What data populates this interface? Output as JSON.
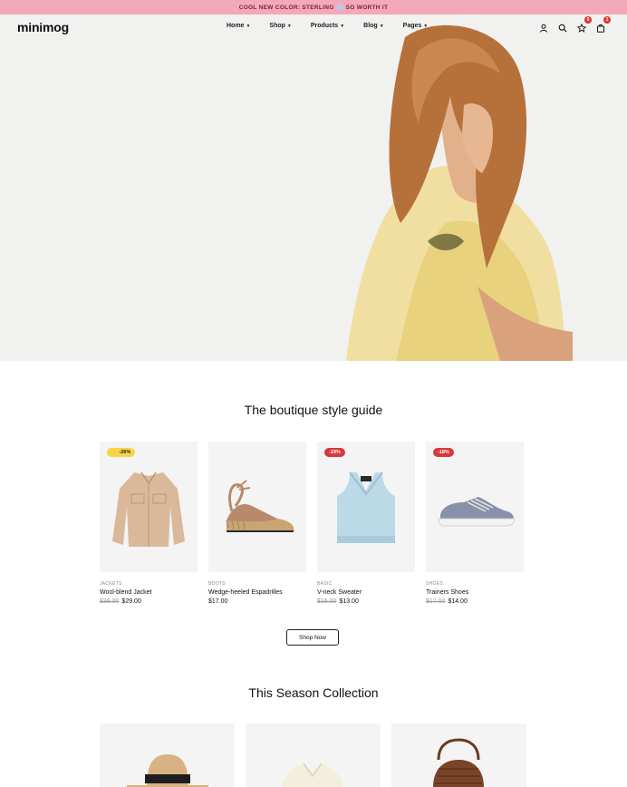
{
  "announcement": {
    "text_before": "COOL NEW COLOR: STERLING",
    "text_after": "SO WORTH IT"
  },
  "header": {
    "logo": "minimog",
    "nav": [
      {
        "label": "Home"
      },
      {
        "label": "Shop"
      },
      {
        "label": "Products"
      },
      {
        "label": "Blog"
      },
      {
        "label": "Pages"
      }
    ],
    "icons": [
      "user-icon",
      "search-icon",
      "star-icon",
      "bag-icon"
    ],
    "wishlist_count": "0",
    "cart_count": "1"
  },
  "sections": {
    "style_guide_title": "The boutique style guide",
    "collection_title": "This Season Collection",
    "shop_now": "Shop Now"
  },
  "products": [
    {
      "badge": "⚡ -26%",
      "category": "JACKETS",
      "name": "Wool-blend Jacket",
      "old_price": "$39.00",
      "price": "$29.00"
    },
    {
      "badge": "",
      "category": "BOOTS",
      "name": "Wedge-heeled Espadrilles",
      "old_price": "",
      "price": "$17.00"
    },
    {
      "badge": "-19%",
      "category": "BASIC",
      "name": "V-neck Sweater",
      "old_price": "$16.00",
      "price": "$13.00"
    },
    {
      "badge": "-18%",
      "category": "SHOES",
      "name": "Trainers Shoes",
      "old_price": "$17.00",
      "price": "$14.00"
    }
  ],
  "colors": {
    "announce_bg": "#f4a9bb",
    "badge_red": "#d8383c",
    "badge_yellow": "#f7d54a",
    "hero_bg": "#f1f1f0"
  }
}
